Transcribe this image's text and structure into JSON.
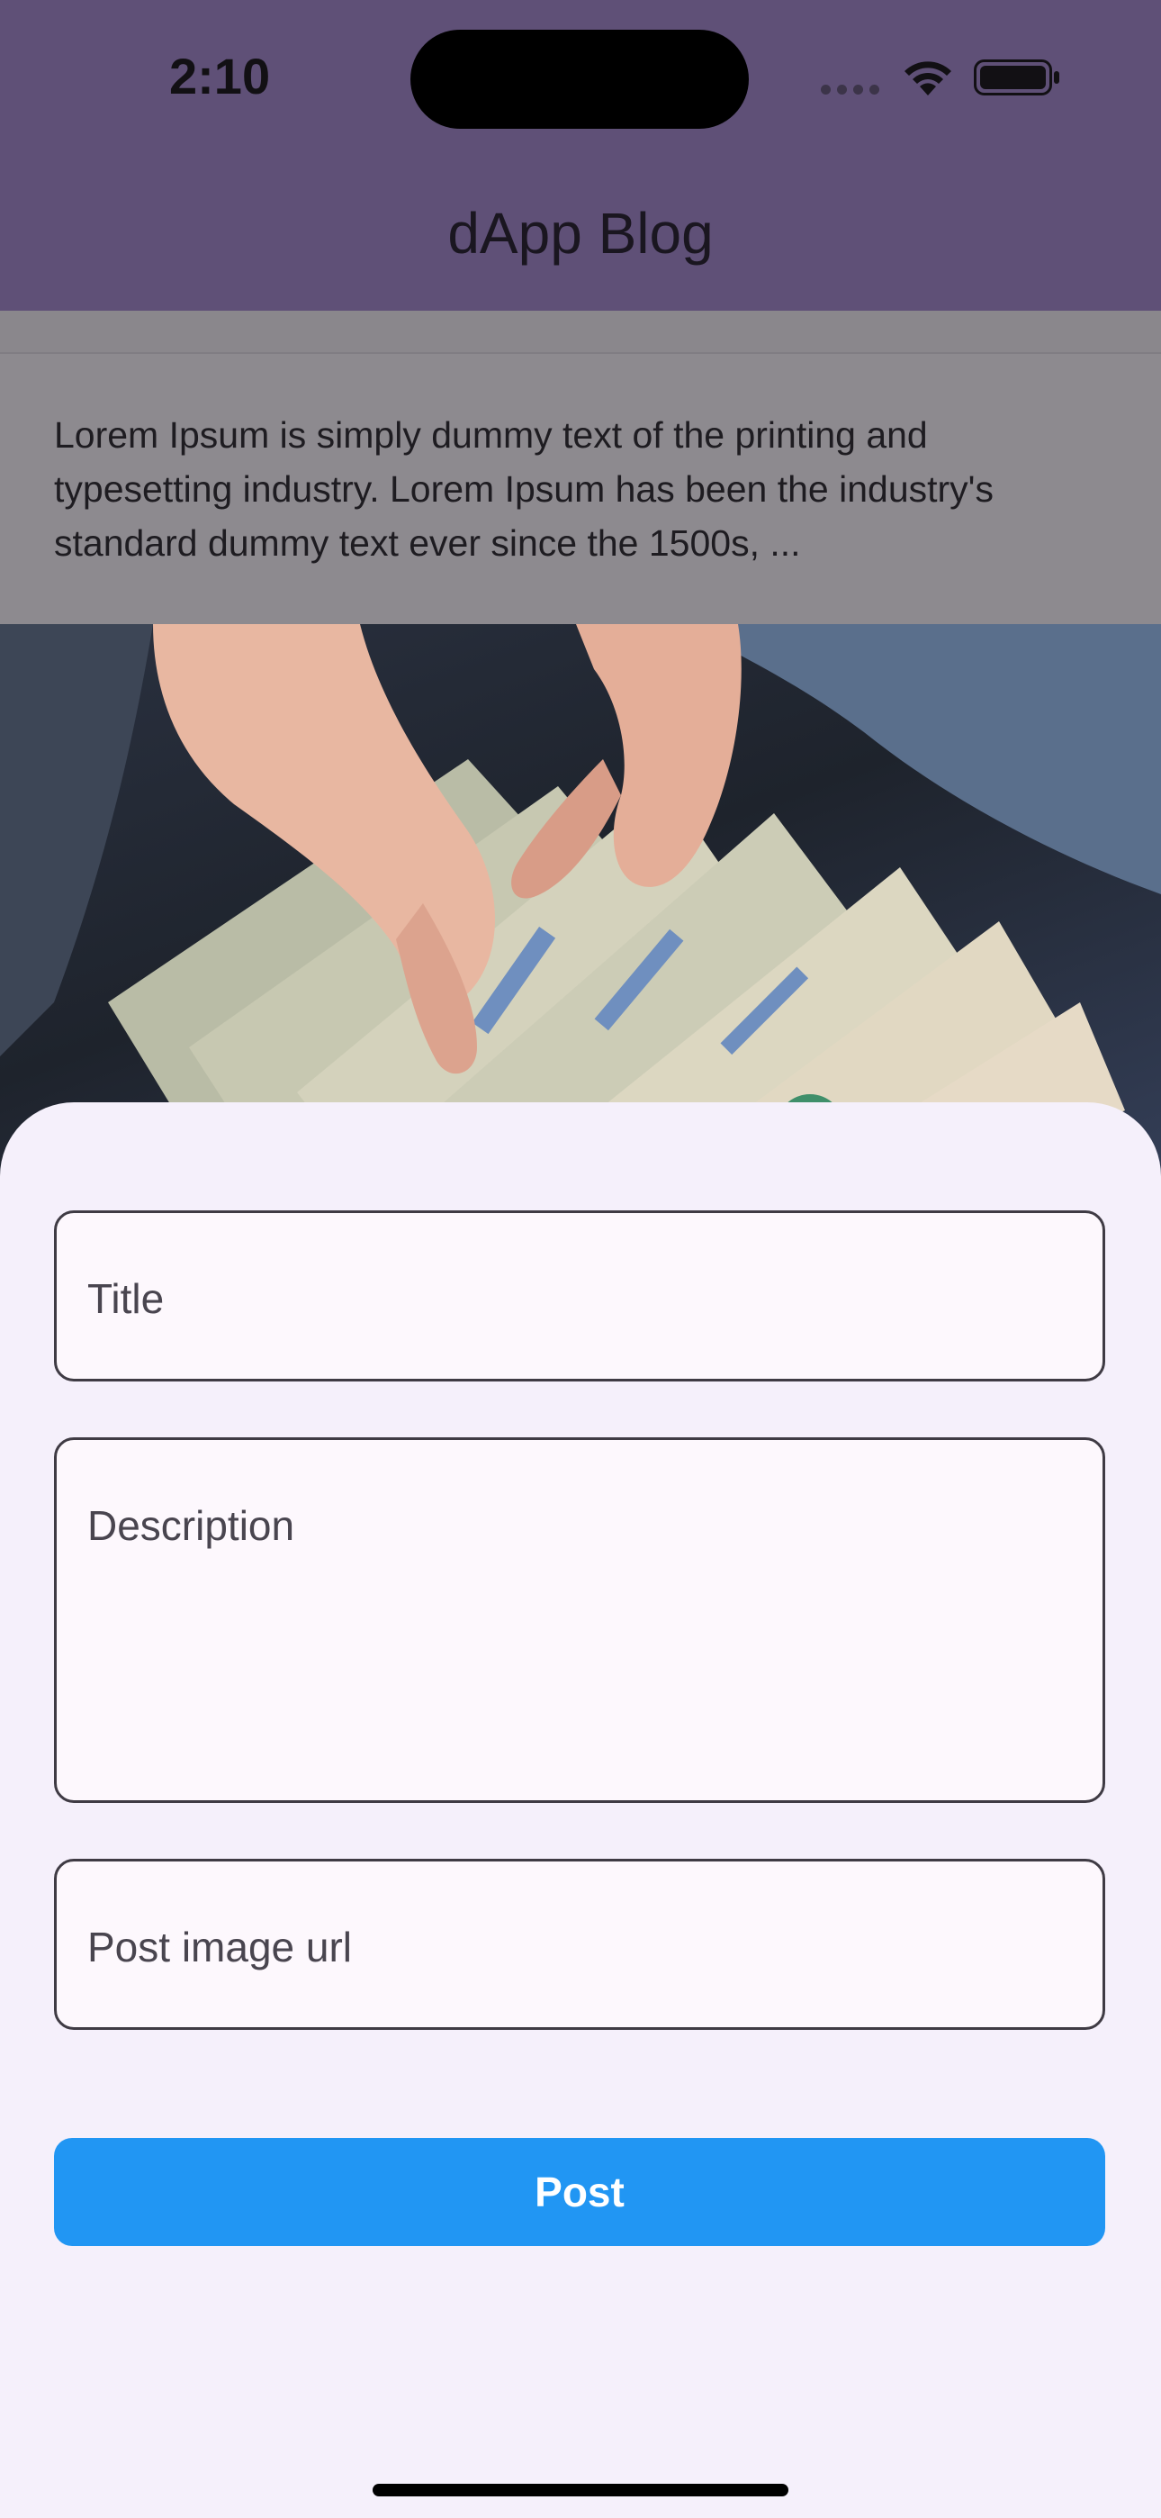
{
  "status_bar": {
    "time": "2:10",
    "icons": [
      "cellular-icon",
      "wifi-icon",
      "battery-icon"
    ]
  },
  "app_bar": {
    "title": "dApp Blog"
  },
  "feed": {
    "excerpt": "Lorem Ipsum is simply dummy text of the printing and typesetting industry. Lorem Ipsum has been the industry's standard dummy text ever since the 1500s, ...",
    "image_description": "hands counting US dollar bills"
  },
  "form": {
    "title_label": "Title",
    "title_value": "",
    "description_label": "Description",
    "description_value": "",
    "image_url_label": "Post image url",
    "image_url_value": "",
    "post_button_label": "Post"
  },
  "colors": {
    "app_bar": "#5f5077",
    "sheet_background": "#f5f0fb",
    "field_border": "#3f3b44",
    "post_button": "#2196f3",
    "post_button_text": "#ffffff"
  }
}
